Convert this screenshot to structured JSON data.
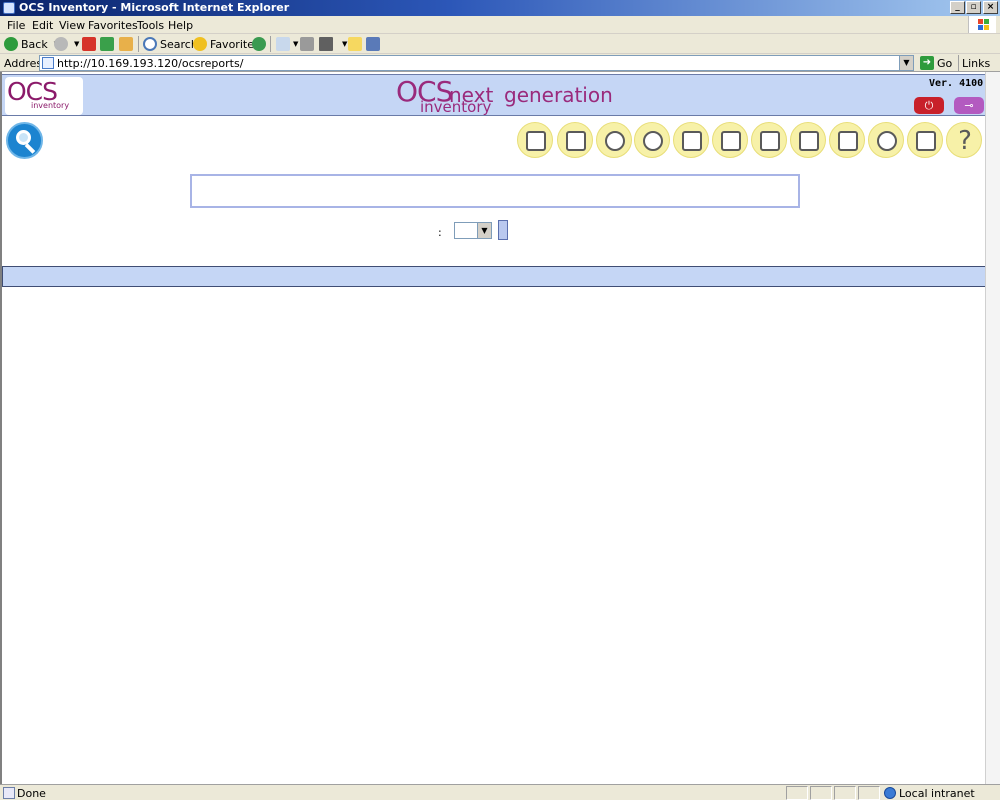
{
  "window": {
    "title": "OCS Inventory - Microsoft Internet Explorer",
    "controls": {
      "minimize": "_",
      "maximize": "▫",
      "close": "×"
    }
  },
  "menu": {
    "items": [
      "File",
      "Edit",
      "View",
      "Favorites",
      "Tools",
      "Help"
    ]
  },
  "toolbar": {
    "back_label": "Back",
    "search_label": "Search",
    "favorites_label": "Favorites"
  },
  "address": {
    "label": "Address",
    "url": "http://10.169.193.120/ocsreports/",
    "go_label": "Go",
    "links_label": "Links",
    "chevron": "»"
  },
  "ocs": {
    "logo_text": "OCS",
    "logo_sub": "inventory",
    "title_ocs": "OCS",
    "title_next": "next",
    "title_inventory": "inventory",
    "title_generation": "generation",
    "version": "Ver. 4100",
    "nav_icons": [
      "gift-icon",
      "factory-icon",
      "agent-icon",
      "gears-icon",
      "wrench-icon",
      "database-icon",
      "documents-icon",
      "wallet-icon",
      "scroll-icon",
      "agent-alt-icon",
      "back-screen-icon",
      "help-icon"
    ],
    "help_glyph": "?",
    "select_colon": ":"
  },
  "status": {
    "text": "Done",
    "zone": "Local intranet"
  },
  "colors": {
    "header_bg": "#c5d6f5",
    "brand": "#9a2a7c",
    "nav_circle": "#f7f1a8",
    "logout": "#c8202a",
    "admin": "#b35ac0"
  }
}
